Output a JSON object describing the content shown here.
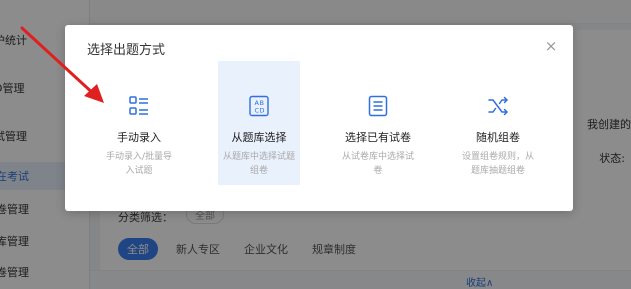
{
  "sidebar": {
    "items": [
      {
        "label": "护统计",
        "expanded": false
      },
      {
        "label": "D管理",
        "expanded": false
      },
      {
        "label": "试管理",
        "expanded": true
      },
      {
        "label": "在考试",
        "active": true
      },
      {
        "label": "卷管理"
      },
      {
        "label": "库管理"
      },
      {
        "label": "卷管理"
      }
    ]
  },
  "background": {
    "right_text": "我创建的",
    "status_label": "状态:",
    "filter_label": "分类筛选：",
    "filter_pill": "全部",
    "tabs": [
      "全部",
      "新人专区",
      "企业文化",
      "规章制度"
    ],
    "collapse_label": "收起∧"
  },
  "modal": {
    "title": "选择出题方式",
    "close_symbol": "×",
    "options": [
      {
        "icon": "manual-entry-icon",
        "label": "手动录入",
        "desc_lines": [
          "手动录入/批量导",
          "入试题"
        ],
        "selected": false
      },
      {
        "icon": "question-bank-icon",
        "label": "从题库选择",
        "desc_lines": [
          "从题库中选择试题",
          "组卷"
        ],
        "selected": true
      },
      {
        "icon": "existing-paper-icon",
        "label": "选择已有试卷",
        "desc_lines": [
          "从试卷库中选择试",
          "卷"
        ],
        "selected": false
      },
      {
        "icon": "shuffle-icon",
        "label": "随机组卷",
        "desc_lines": [
          "设置组卷规则，从",
          "题库抽题组卷"
        ],
        "selected": false
      }
    ]
  },
  "colors": {
    "accent": "#3b7ff0",
    "icon": "#2f6fe0",
    "selected_bg": "#e9f1fd",
    "annotation_arrow": "#e02020"
  }
}
